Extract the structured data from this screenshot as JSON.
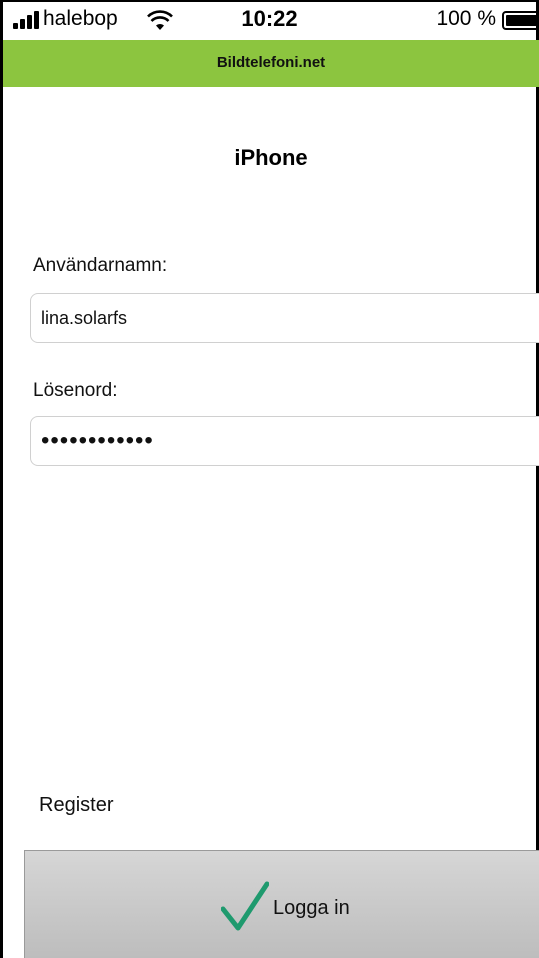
{
  "status_bar": {
    "carrier": "halebop",
    "time": "10:22",
    "battery_percent": "100 %"
  },
  "header": {
    "title": "Bildtelefoni.net",
    "accent_color": "#8cc53f"
  },
  "device": {
    "title": "iPhone"
  },
  "form": {
    "username_label": "Användarnamn:",
    "username_value": "lina.solarfs",
    "password_label": "Lösenord:",
    "password_value": "••••••••••••"
  },
  "register_label": "Register",
  "login_button": {
    "label": "Logga in",
    "icon": "check-icon",
    "icon_color": "#1f9a6e"
  }
}
